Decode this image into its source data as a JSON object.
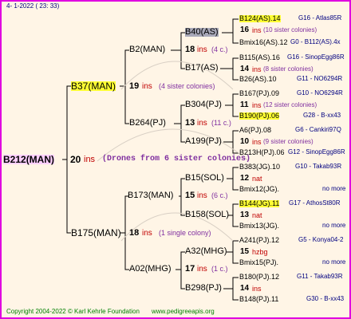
{
  "header": {
    "date": "4-  1-2022 ( 23: 33)"
  },
  "footer": {
    "copyright": "Copyright 2004-2022 © Karl Kehrle Foundation",
    "site": "www.pedigreeapis.org"
  },
  "root": {
    "name": "B212(MAN)",
    "ins": "20",
    "ins_word": "ins",
    "note": "(Drones from 6 sister colonies)"
  },
  "gen1": [
    {
      "name": "B37(MAN)",
      "ins": "19",
      "ins_word": "ins",
      "note": "(4 sister colonies)"
    },
    {
      "name": "B175(MAN)",
      "ins": "18",
      "ins_word": "ins",
      "note": "(1 single colony)"
    }
  ],
  "gen2": [
    {
      "name": "B2(MAN)",
      "ins": "18",
      "ins_word": "ins",
      "note": "(4 c.)"
    },
    {
      "name": "B264(PJ)",
      "ins": "13",
      "ins_word": "ins",
      "note": "(11 c.)"
    },
    {
      "name": "B173(MAN)",
      "ins": "15",
      "ins_word": "ins",
      "note": "(6 c.)"
    },
    {
      "name": "A02(MHG)",
      "ins": "17",
      "ins_word": "ins",
      "note": "(1 c.)"
    }
  ],
  "gen3": [
    {
      "name": "B40(AS)"
    },
    {
      "name": "B17(AS)"
    },
    {
      "name": "B304(PJ)"
    },
    {
      "name": "A199(PJ)"
    },
    {
      "name": "B15(SOL)"
    },
    {
      "name": "B158(SOL)"
    },
    {
      "name": "A32(MHG)"
    },
    {
      "name": "B298(PJ)"
    }
  ],
  "gen4": [
    {
      "top": "B124(AS).14",
      "top_right": "G16 - Atlas85R",
      "mid_n": "16",
      "mid_w": "ins",
      "mid_note": "(10 sister colonies)",
      "bot": "Bmix16(AS).12",
      "bot_right": "G0 - B112(AS).4x"
    },
    {
      "top": "B115(AS).16",
      "top_right": "G16 - SinopEgg86R",
      "mid_n": "14",
      "mid_w": "ins",
      "mid_note": "(8 sister colonies)",
      "bot": "B26(AS).10",
      "bot_right": "G11 - NO6294R"
    },
    {
      "top": "B167(PJ).09",
      "top_right": "G10 - NO6294R",
      "mid_n": "11",
      "mid_w": "ins",
      "mid_note": "(12 sister colonies)",
      "bot": "B190(PJ).06",
      "bot_right": "G28 - B-xx43"
    },
    {
      "top": "A6(PJ).08",
      "top_right": "G6 - Cankiri97Q",
      "mid_n": "10",
      "mid_w": "ins",
      "mid_note": "(9 sister colonies)",
      "bot": "B213H(PJ).06",
      "bot_right": "G12 - SinopEgg86R"
    },
    {
      "top": "B383(JG).10",
      "top_right": "G10 - Takab93R",
      "mid_n": "12",
      "mid_w": "nat",
      "mid_note": "",
      "bot": "Bmix12(JG).",
      "bot_right": "no more"
    },
    {
      "top": "B144(JG).11",
      "top_right": "G17 - AthosSt80R",
      "mid_n": "13",
      "mid_w": "nat",
      "mid_note": "",
      "bot": "Bmix13(JG).",
      "bot_right": "no more"
    },
    {
      "top": "A241(PJ).12",
      "top_right": "G5 - Konya04-2",
      "mid_n": "15",
      "mid_w": "hzbg",
      "mid_note": "",
      "bot": "Bmix15(PJ).",
      "bot_right": "no more"
    },
    {
      "top": "B180(PJ).12",
      "top_right": "G11 - Takab93R",
      "mid_n": "14",
      "mid_w": "ins",
      "mid_note": "",
      "bot": "B148(PJ).11",
      "bot_right": "G30 - B-xx43"
    }
  ]
}
